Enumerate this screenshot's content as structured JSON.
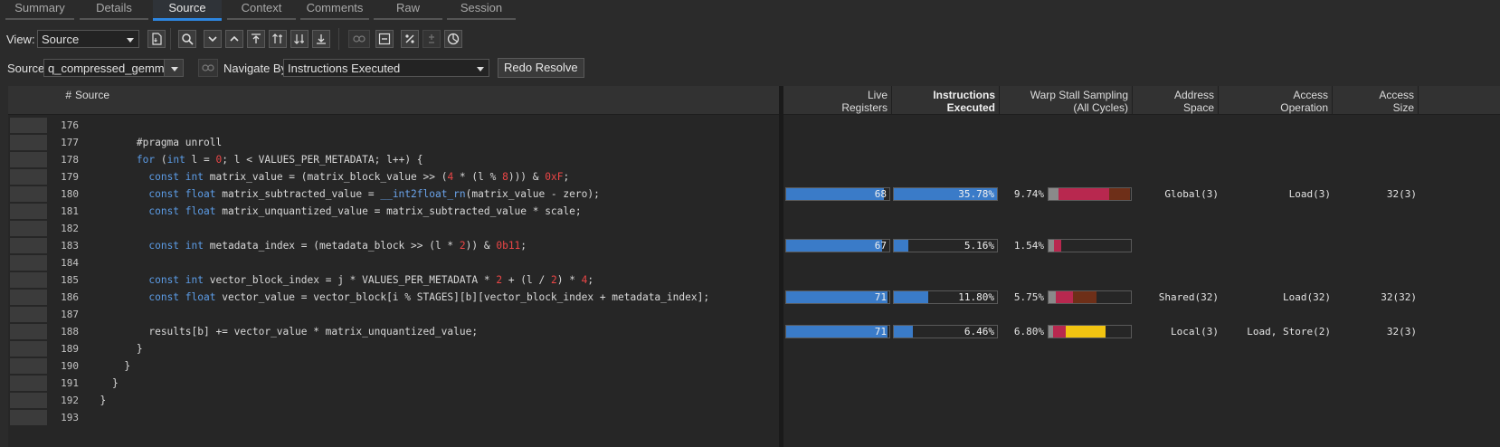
{
  "tabs": [
    {
      "label": "Summary",
      "active": false
    },
    {
      "label": "Details",
      "active": false
    },
    {
      "label": "Source",
      "active": true
    },
    {
      "label": "Context",
      "active": false
    },
    {
      "label": "Comments",
      "active": false
    },
    {
      "label": "Raw",
      "active": false
    },
    {
      "label": "Session",
      "active": false
    }
  ],
  "toolbar": {
    "view_label": "View:",
    "view_value": "Source",
    "source_label": "Source:",
    "source_value": "q_compressed_gemm.cu",
    "navigate_label": "Navigate By:",
    "navigate_value": "Instructions Executed",
    "redo_label": "Redo Resolve"
  },
  "source_header": {
    "hash": "#",
    "title": "Source"
  },
  "metric_headers": [
    {
      "line1": "Live",
      "line2": "Registers",
      "bold": false
    },
    {
      "line1": "Instructions",
      "line2": "Executed",
      "bold": true
    },
    {
      "line1": "Warp Stall Sampling",
      "line2": "(All Cycles)",
      "bold": false
    },
    {
      "line1": "Address",
      "line2": "Space",
      "bold": false
    },
    {
      "line1": "Access",
      "line2": "Operation",
      "bold": false
    },
    {
      "line1": "Access",
      "line2": "Size",
      "bold": false
    }
  ],
  "lines": [
    {
      "num": "176",
      "code": ""
    },
    {
      "num": "177",
      "code": "        #pragma unroll"
    },
    {
      "num": "178",
      "code": "        for (int l = 0; l < VALUES_PER_METADATA; l++) {"
    },
    {
      "num": "179",
      "code": "          const int matrix_value = (matrix_block_value >> (4 * (l % 8))) & 0xF;"
    },
    {
      "num": "180",
      "code": "          const float matrix_subtracted_value = __int2float_rn(matrix_value - zero);",
      "metrics": {
        "live_registers": 68,
        "instructions_executed": "35.78%",
        "instr_pct": 35.78,
        "stall": "9.74%",
        "stall_pct": 9.74,
        "address_space": "Global(3)",
        "access_operation": "Load(3)",
        "access_size": "32(3)"
      }
    },
    {
      "num": "181",
      "code": "          const float matrix_unquantized_value = matrix_subtracted_value * scale;"
    },
    {
      "num": "182",
      "code": ""
    },
    {
      "num": "183",
      "code": "          const int metadata_index = (metadata_block >> (l * 2)) & 0b11;",
      "metrics": {
        "live_registers": 67,
        "instructions_executed": "5.16%",
        "instr_pct": 5.16,
        "stall": "1.54%",
        "stall_pct": 1.54,
        "address_space": "",
        "access_operation": "",
        "access_size": ""
      }
    },
    {
      "num": "184",
      "code": ""
    },
    {
      "num": "185",
      "code": "          const int vector_block_index = j * VALUES_PER_METADATA * 2 + (l / 2) * 4;"
    },
    {
      "num": "186",
      "code": "          const float vector_value = vector_block[i % STAGES][b][vector_block_index + metadata_index];",
      "metrics": {
        "live_registers": 71,
        "instructions_executed": "11.80%",
        "instr_pct": 11.8,
        "stall": "5.75%",
        "stall_pct": 5.75,
        "address_space": "Shared(32)",
        "access_operation": "Load(32)",
        "access_size": "32(32)"
      }
    },
    {
      "num": "187",
      "code": ""
    },
    {
      "num": "188",
      "code": "          results[b] += vector_value * matrix_unquantized_value;",
      "metrics": {
        "live_registers": 71,
        "instructions_executed": "6.46%",
        "instr_pct": 6.46,
        "stall": "6.80%",
        "stall_pct": 6.8,
        "address_space": "Local(3)",
        "access_operation": "Load, Store(2)",
        "access_size": "32(3)"
      }
    },
    {
      "num": "189",
      "code": "        }"
    },
    {
      "num": "190",
      "code": "      }"
    },
    {
      "num": "191",
      "code": "    }"
    },
    {
      "num": "192",
      "code": "  }"
    },
    {
      "num": "193",
      "code": ""
    }
  ],
  "colors": {
    "accent": "#2d86e0",
    "bar_blue": "#3a7bc8",
    "keyword": "#5c9ce6",
    "number": "#ec4646",
    "stall_gray": "#8a8a8a",
    "stall_magenta": "#b8284f",
    "stall_brown": "#6e2f18",
    "stall_yellow": "#f2c411"
  }
}
